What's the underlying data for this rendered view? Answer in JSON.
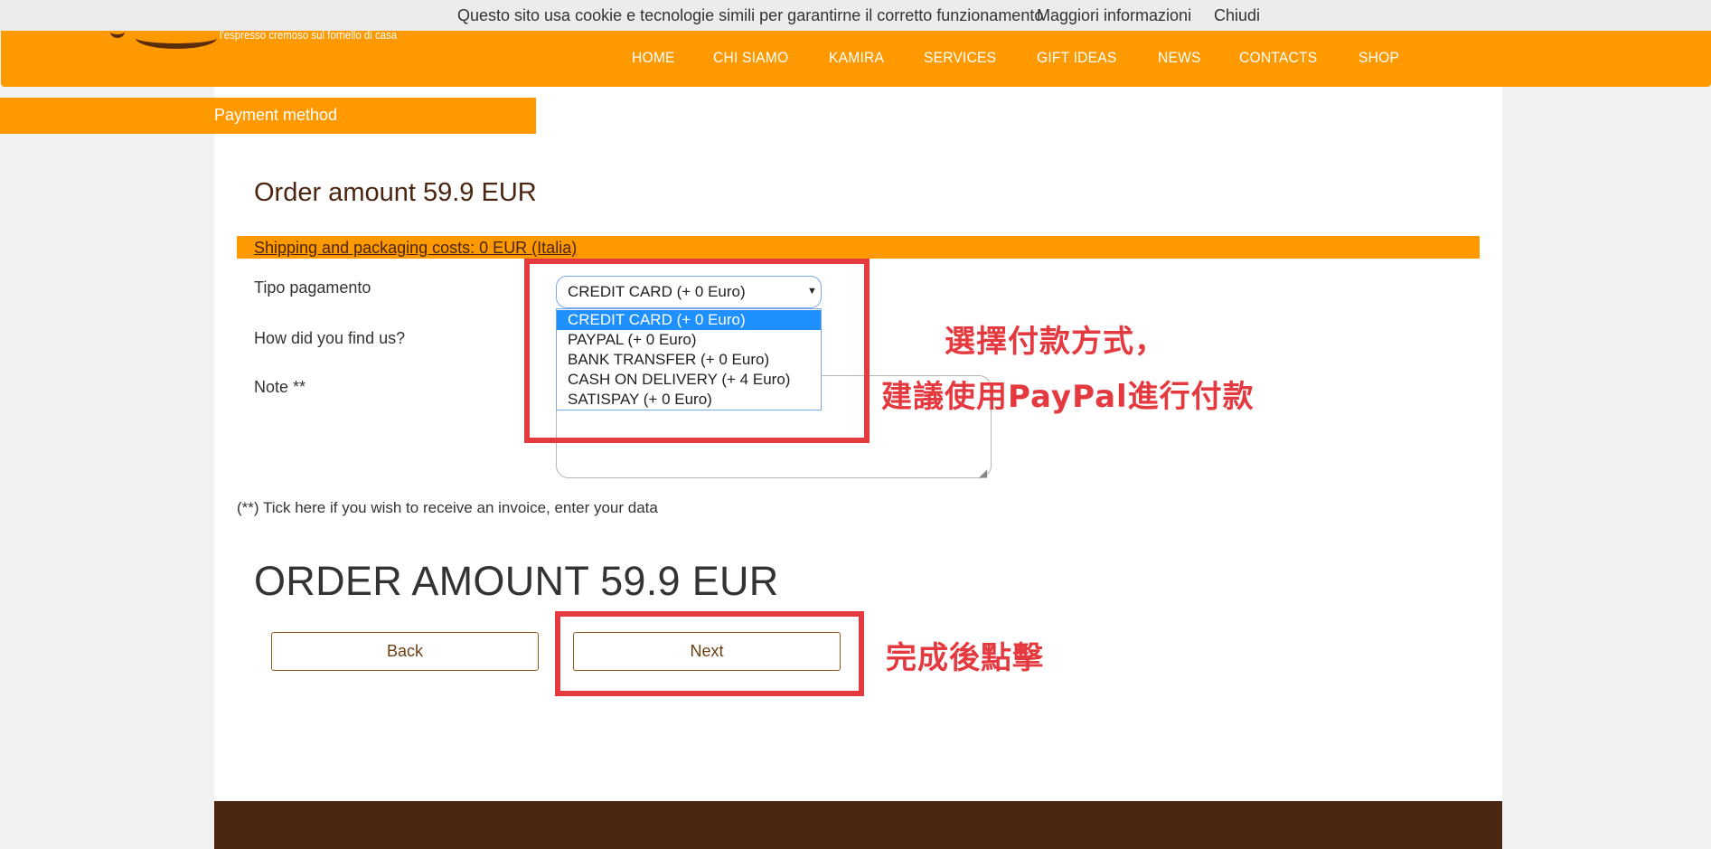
{
  "header": {
    "tagline": "l'espresso cremoso sul fornello di casa",
    "nav": [
      "HOME",
      "CHI SIAMO",
      "KAMIRA",
      "SERVICES",
      "GIFT IDEAS",
      "NEWS",
      "CONTACTS",
      "SHOP"
    ]
  },
  "cookie": {
    "text": "Questo sito usa cookie e tecnologie simili per garantirne il corretto funzionamento",
    "more_link": "Maggiori informazioni",
    "close": "Chiudi"
  },
  "step": {
    "label": "Payment method"
  },
  "order": {
    "title": "Order amount 59.9 EUR",
    "shipping": "Shipping and packaging costs: 0 EUR (Italia)",
    "big_total": "ORDER AMOUNT 59.9 EUR"
  },
  "form": {
    "payment_label": "Tipo pagamento",
    "find_label": "How did you find us?",
    "note_label": "Note **",
    "payment_selected": "CREDIT CARD (+ 0 Euro)",
    "payment_options": [
      "CREDIT CARD (+ 0 Euro)",
      "PAYPAL (+ 0 Euro)",
      "BANK TRANSFER (+ 0 Euro)",
      "CASH ON DELIVERY (+ 4 Euro)",
      "SATISPAY (+ 0 Euro)"
    ],
    "invoice_note": "(**) Tick here if you wish to receive an invoice, enter your data"
  },
  "buttons": {
    "back": "Back",
    "next": "Next"
  },
  "annotations": {
    "line1": "選擇付款方式，",
    "line2": "建議使用PayPal進行付款",
    "line3": "完成後點擊"
  },
  "colors": {
    "accent": "#ff9900",
    "brown": "#4a2712",
    "annotation": "#e53940",
    "selected_option": "#1e90ff"
  }
}
